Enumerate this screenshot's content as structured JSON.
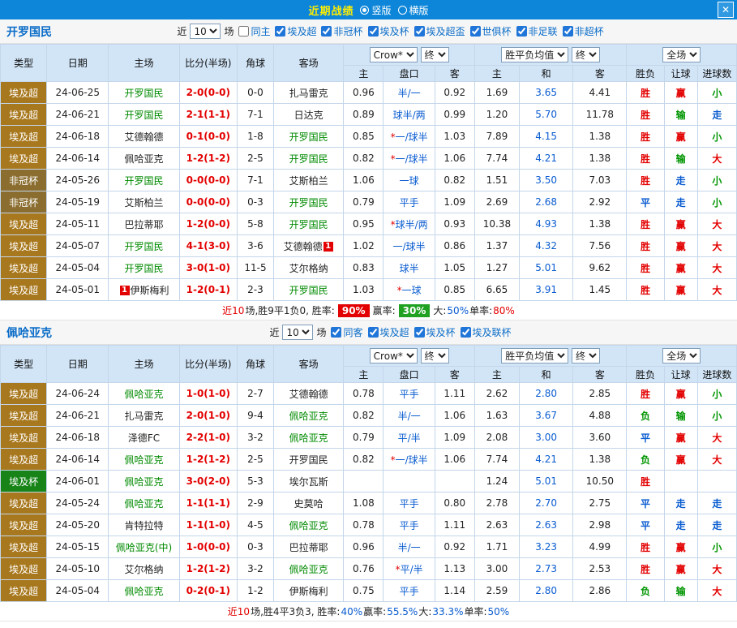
{
  "topbar": {
    "title": "近期战绩",
    "radio_vertical": "竖版",
    "radio_horizontal": "横版",
    "close": "✕"
  },
  "labels": {
    "near": "近",
    "games": "场"
  },
  "table_header": {
    "col_type": "类型",
    "col_date": "日期",
    "col_home": "主场",
    "col_score": "比分(半场)",
    "col_corner": "角球",
    "col_away": "客场",
    "odds_select": "Crow*",
    "final_select": "终",
    "avg_select": "胜平负均值",
    "final2_select": "终",
    "full_select": "全场",
    "sub_home": "主",
    "sub_handicap": "盘口",
    "sub_away": "客",
    "sub_home2": "主",
    "sub_draw": "和",
    "sub_away2": "客",
    "sub_wl": "胜负",
    "sub_ah": "让球",
    "sub_goals": "进球数"
  },
  "colors": {
    "type_bg": {
      "埃及超": "#a8781e",
      "非冠杯": "#8a6d2f",
      "埃及杯": "#188418"
    },
    "result": {
      "胜": "#e30000",
      "平": "#0a5cd0",
      "负": "#009500",
      "赢": "#e30000",
      "输": "#009500",
      "走": "#0a5cd0",
      "大": "#e30000",
      "小": "#009500"
    }
  },
  "sections": [
    {
      "team": "开罗国民",
      "filter": {
        "count": "10",
        "checkboxes": [
          {
            "label": "同主",
            "checked": false
          },
          {
            "label": "埃及超",
            "checked": true
          },
          {
            "label": "非冠杯",
            "checked": true
          },
          {
            "label": "埃及杯",
            "checked": true
          },
          {
            "label": "埃及超盃",
            "checked": true
          },
          {
            "label": "世俱杯",
            "checked": true
          },
          {
            "label": "非足联",
            "checked": true
          },
          {
            "label": "非超杯",
            "checked": true
          }
        ]
      },
      "rows": [
        {
          "type": "埃及超",
          "date": "24-06-25",
          "home": "开罗国民",
          "home_green": true,
          "score": "2-0(0-0)",
          "corner": "0-0",
          "away": "扎马雷克",
          "o1": "0.96",
          "hcp": "半/一",
          "o2": "0.92",
          "a1": "1.69",
          "a2": "3.65",
          "a3": "4.41",
          "r1": "胜",
          "r2": "赢",
          "r3": "小"
        },
        {
          "type": "埃及超",
          "date": "24-06-21",
          "home": "开罗国民",
          "home_green": true,
          "score": "2-1(1-1)",
          "corner": "7-1",
          "away": "日达克",
          "o1": "0.89",
          "hcp": "球半/两",
          "o2": "0.99",
          "a1": "1.20",
          "a2": "5.70",
          "a3": "11.78",
          "r1": "胜",
          "r2": "输",
          "r3": "走"
        },
        {
          "type": "埃及超",
          "date": "24-06-18",
          "home": "艾德翰德",
          "score": "0-1(0-0)",
          "corner": "1-8",
          "away": "开罗国民",
          "away_green": true,
          "o1": "0.85",
          "star": true,
          "hcp": "一/球半",
          "o2": "1.03",
          "a1": "7.89",
          "a2": "4.15",
          "a3": "1.38",
          "r1": "胜",
          "r2": "赢",
          "r3": "小"
        },
        {
          "type": "埃及超",
          "date": "24-06-14",
          "home": "佩哈亚克",
          "score": "1-2(1-2)",
          "corner": "2-5",
          "away": "开罗国民",
          "away_green": true,
          "o1": "0.82",
          "star": true,
          "hcp": "一/球半",
          "o2": "1.06",
          "a1": "7.74",
          "a2": "4.21",
          "a3": "1.38",
          "r1": "胜",
          "r2": "输",
          "r3": "大"
        },
        {
          "type": "非冠杯",
          "date": "24-05-26",
          "home": "开罗国民",
          "home_green": true,
          "score": "0-0(0-0)",
          "corner": "7-1",
          "away": "艾斯柏兰",
          "o1": "1.06",
          "hcp": "一球",
          "o2": "0.82",
          "a1": "1.51",
          "a2": "3.50",
          "a3": "7.03",
          "r1": "胜",
          "r2": "走",
          "r3": "小"
        },
        {
          "type": "非冠杯",
          "date": "24-05-19",
          "home": "艾斯柏兰",
          "score": "0-0(0-0)",
          "corner": "0-3",
          "away": "开罗国民",
          "away_green": true,
          "o1": "0.79",
          "hcp": "平手",
          "o2": "1.09",
          "a1": "2.69",
          "a2": "2.68",
          "a3": "2.92",
          "r1": "平",
          "r2": "走",
          "r3": "小"
        },
        {
          "type": "埃及超",
          "date": "24-05-11",
          "home": "巴拉蒂耶",
          "score": "1-2(0-0)",
          "corner": "5-8",
          "away": "开罗国民",
          "away_green": true,
          "o1": "0.95",
          "star": true,
          "hcp": "球半/两",
          "o2": "0.93",
          "a1": "10.38",
          "a2": "4.93",
          "a3": "1.38",
          "r1": "胜",
          "r2": "赢",
          "r3": "大"
        },
        {
          "type": "埃及超",
          "date": "24-05-07",
          "home": "开罗国民",
          "home_green": true,
          "score": "4-1(3-0)",
          "corner": "3-6",
          "away": "艾德翰德",
          "away_badge": "1",
          "away_badge_pos": "right",
          "o1": "1.02",
          "hcp": "一/球半",
          "o2": "0.86",
          "a1": "1.37",
          "a2": "4.32",
          "a3": "7.56",
          "r1": "胜",
          "r2": "赢",
          "r3": "大"
        },
        {
          "type": "埃及超",
          "date": "24-05-04",
          "home": "开罗国民",
          "home_green": true,
          "score": "3-0(1-0)",
          "corner": "11-5",
          "away": "艾尔格纳",
          "o1": "0.83",
          "hcp": "球半",
          "o2": "1.05",
          "a1": "1.27",
          "a2": "5.01",
          "a3": "9.62",
          "r1": "胜",
          "r2": "赢",
          "r3": "大"
        },
        {
          "type": "埃及超",
          "date": "24-05-01",
          "home": "伊斯梅利",
          "home_badge": "1",
          "home_badge_pos": "left",
          "score": "1-2(0-1)",
          "corner": "2-3",
          "away": "开罗国民",
          "away_green": true,
          "o1": "1.03",
          "star": true,
          "hcp": "一球",
          "o2": "0.85",
          "a1": "6.65",
          "a2": "3.91",
          "a3": "1.45",
          "r1": "胜",
          "r2": "赢",
          "r3": "大"
        }
      ],
      "summary": [
        {
          "text": "近10",
          "cls": "red"
        },
        {
          "text": "场,胜9平1负0, 胜率: ",
          "cls": "black"
        },
        {
          "text": "90%",
          "cls": "badge-red"
        },
        {
          "text": " 赢率: ",
          "cls": "black"
        },
        {
          "text": "30%",
          "cls": "badge-green"
        },
        {
          "text": " 大:",
          "cls": "black"
        },
        {
          "text": "50%",
          "cls": "blue"
        },
        {
          "text": " 单率:",
          "cls": "black"
        },
        {
          "text": "80%",
          "cls": "red"
        }
      ]
    },
    {
      "team": "佩哈亚克",
      "filter": {
        "count": "10",
        "checkboxes": [
          {
            "label": "同客",
            "checked": true
          },
          {
            "label": "埃及超",
            "checked": true
          },
          {
            "label": "埃及杯",
            "checked": true
          },
          {
            "label": "埃及联杯",
            "checked": true
          }
        ]
      },
      "rows": [
        {
          "type": "埃及超",
          "date": "24-06-24",
          "home": "佩哈亚克",
          "home_green": true,
          "score": "1-0(1-0)",
          "corner": "2-7",
          "away": "艾德翰德",
          "o1": "0.78",
          "hcp": "平手",
          "o2": "1.11",
          "a1": "2.62",
          "a2": "2.80",
          "a3": "2.85",
          "r1": "胜",
          "r2": "赢",
          "r3": "小"
        },
        {
          "type": "埃及超",
          "date": "24-06-21",
          "home": "扎马雷克",
          "score": "2-0(1-0)",
          "corner": "9-4",
          "away": "佩哈亚克",
          "away_green": true,
          "o1": "0.82",
          "hcp": "半/一",
          "o2": "1.06",
          "a1": "1.63",
          "a2": "3.67",
          "a3": "4.88",
          "r1": "负",
          "r2": "输",
          "r3": "小"
        },
        {
          "type": "埃及超",
          "date": "24-06-18",
          "home": "泽德FC",
          "score": "2-2(1-0)",
          "corner": "3-2",
          "away": "佩哈亚克",
          "away_green": true,
          "o1": "0.79",
          "hcp": "平/半",
          "o2": "1.09",
          "a1": "2.08",
          "a2": "3.00",
          "a3": "3.60",
          "r1": "平",
          "r2": "赢",
          "r3": "大"
        },
        {
          "type": "埃及超",
          "date": "24-06-14",
          "home": "佩哈亚克",
          "home_green": true,
          "score": "1-2(1-2)",
          "corner": "2-5",
          "away": "开罗国民",
          "o1": "0.82",
          "star": true,
          "hcp": "一/球半",
          "o2": "1.06",
          "a1": "7.74",
          "a2": "4.21",
          "a3": "1.38",
          "r1": "负",
          "r2": "赢",
          "r3": "大"
        },
        {
          "type": "埃及杯",
          "date": "24-06-01",
          "home": "佩哈亚克",
          "home_green": true,
          "score": "3-0(2-0)",
          "corner": "5-3",
          "away": "埃尔瓦斯",
          "o1": "",
          "hcp": "",
          "o2": "",
          "a1": "1.24",
          "a2": "5.01",
          "a3": "10.50",
          "r1": "胜",
          "r2": "",
          "r3": ""
        },
        {
          "type": "埃及超",
          "date": "24-05-24",
          "home": "佩哈亚克",
          "home_green": true,
          "score": "1-1(1-1)",
          "corner": "2-9",
          "away": "史莫哈",
          "o1": "1.08",
          "hcp": "平手",
          "o2": "0.80",
          "a1": "2.78",
          "a2": "2.70",
          "a3": "2.75",
          "r1": "平",
          "r2": "走",
          "r3": "走"
        },
        {
          "type": "埃及超",
          "date": "24-05-20",
          "home": "肯特拉特",
          "score": "1-1(1-0)",
          "corner": "4-5",
          "away": "佩哈亚克",
          "away_green": true,
          "o1": "0.78",
          "hcp": "平手",
          "o2": "1.11",
          "a1": "2.63",
          "a2": "2.63",
          "a3": "2.98",
          "r1": "平",
          "r2": "走",
          "r3": "走"
        },
        {
          "type": "埃及超",
          "date": "24-05-15",
          "home": "佩哈亚克(中)",
          "home_green": true,
          "score": "1-0(0-0)",
          "corner": "0-3",
          "away": "巴拉蒂耶",
          "o1": "0.96",
          "hcp": "半/一",
          "o2": "0.92",
          "a1": "1.71",
          "a2": "3.23",
          "a3": "4.99",
          "r1": "胜",
          "r2": "赢",
          "r3": "小"
        },
        {
          "type": "埃及超",
          "date": "24-05-10",
          "home": "艾尔格纳",
          "score": "1-2(1-2)",
          "corner": "3-2",
          "away": "佩哈亚克",
          "away_green": true,
          "o1": "0.76",
          "star": true,
          "hcp": "平/半",
          "o2": "1.13",
          "a1": "3.00",
          "a2": "2.73",
          "a3": "2.53",
          "r1": "胜",
          "r2": "赢",
          "r3": "大"
        },
        {
          "type": "埃及超",
          "date": "24-05-04",
          "home": "佩哈亚克",
          "home_green": true,
          "score": "0-2(0-1)",
          "corner": "1-2",
          "away": "伊斯梅利",
          "o1": "0.75",
          "hcp": "平手",
          "o2": "1.14",
          "a1": "2.59",
          "a2": "2.80",
          "a3": "2.86",
          "r1": "负",
          "r2": "输",
          "r3": "大"
        }
      ],
      "summary": [
        {
          "text": "近10",
          "cls": "red"
        },
        {
          "text": "场,胜4平3负3, 胜率:",
          "cls": "black"
        },
        {
          "text": "40%",
          "cls": "blue"
        },
        {
          "text": " 赢率:",
          "cls": "black"
        },
        {
          "text": "55.5%",
          "cls": "blue"
        },
        {
          "text": " 大:",
          "cls": "black"
        },
        {
          "text": "33.3%",
          "cls": "blue"
        },
        {
          "text": " 单率:",
          "cls": "black"
        },
        {
          "text": "50%",
          "cls": "blue"
        }
      ]
    }
  ]
}
